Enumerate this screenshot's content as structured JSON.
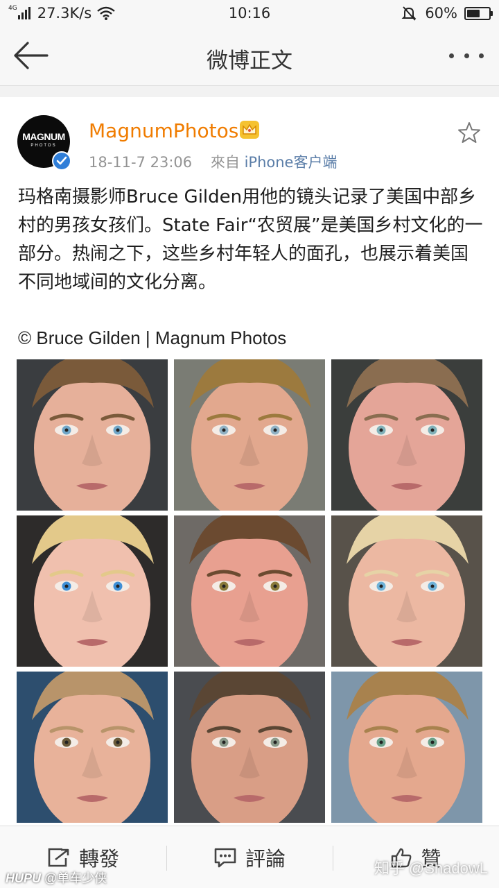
{
  "status_bar": {
    "network": "4G",
    "speed": "27.3K/s",
    "time": "10:16",
    "battery": "60%",
    "battery_level": 0.6
  },
  "nav": {
    "title": "微博正文"
  },
  "post": {
    "user_name": "MagnumPhotos",
    "avatar_text": "MAGNUM",
    "avatar_subtext": "PHOTOS",
    "date": "18-11-7 23:06",
    "source_prefix": "來自",
    "source": "iPhone客户端",
    "text": "玛格南摄影师Bruce Gilden用他的镜头记录了美国中部乡村的男孩女孩们。State Fair“农贸展”是美国乡村文化的一部分。热闹之下，这些乡村年轻人的面孔，也展示着美国不同地域间的文化分离。",
    "credit": "© Bruce Gilden | Magnum Photos",
    "photos": [
      {
        "desc": "portrait-1",
        "skin": "#e6b09a",
        "hair": "#7a5a3a",
        "bg": "#3a3d40",
        "eye": "#6fa6c8"
      },
      {
        "desc": "portrait-2",
        "skin": "#e2a88e",
        "hair": "#9c7a3e",
        "bg": "#7a7c74",
        "eye": "#8fb1c4"
      },
      {
        "desc": "portrait-3",
        "skin": "#e4a598",
        "hair": "#8a6d50",
        "bg": "#3b3e3c",
        "eye": "#7fb0b8"
      },
      {
        "desc": "portrait-4",
        "skin": "#f0c0ae",
        "hair": "#e3c98a",
        "bg": "#2d2b2a",
        "eye": "#3f8fd6"
      },
      {
        "desc": "portrait-5",
        "skin": "#e8a090",
        "hair": "#6b4a30",
        "bg": "#6e6a66",
        "eye": "#8a7a3a"
      },
      {
        "desc": "portrait-6",
        "skin": "#ecb8a2",
        "hair": "#e6d3a6",
        "bg": "#58524a",
        "eye": "#6fb2d8"
      },
      {
        "desc": "portrait-7",
        "skin": "#e8b29a",
        "hair": "#b8946a",
        "bg": "#2d4e6e",
        "eye": "#6a5a3a"
      },
      {
        "desc": "portrait-8",
        "skin": "#d99e86",
        "hair": "#5a4634",
        "bg": "#4a4c50",
        "eye": "#8a9a8a"
      },
      {
        "desc": "portrait-9",
        "skin": "#e4a88e",
        "hair": "#a8824e",
        "bg": "#7e96aa",
        "eye": "#6aa088"
      }
    ]
  },
  "actions": {
    "repost": "轉發",
    "comment": "評論",
    "like": "贊"
  },
  "watermarks": {
    "left_brand": "HUPU",
    "left_user": "@单车少侠",
    "right": "知乎 @ShadowL"
  },
  "colors": {
    "username": "#f07c00",
    "source_link": "#5b7ea8",
    "verified": "#2f7ed8",
    "meta": "#939393"
  },
  "icons": [
    "back-arrow-icon",
    "more-icon",
    "verified-icon",
    "crown-icon",
    "star-icon",
    "repost-icon",
    "comment-icon",
    "like-icon"
  ]
}
